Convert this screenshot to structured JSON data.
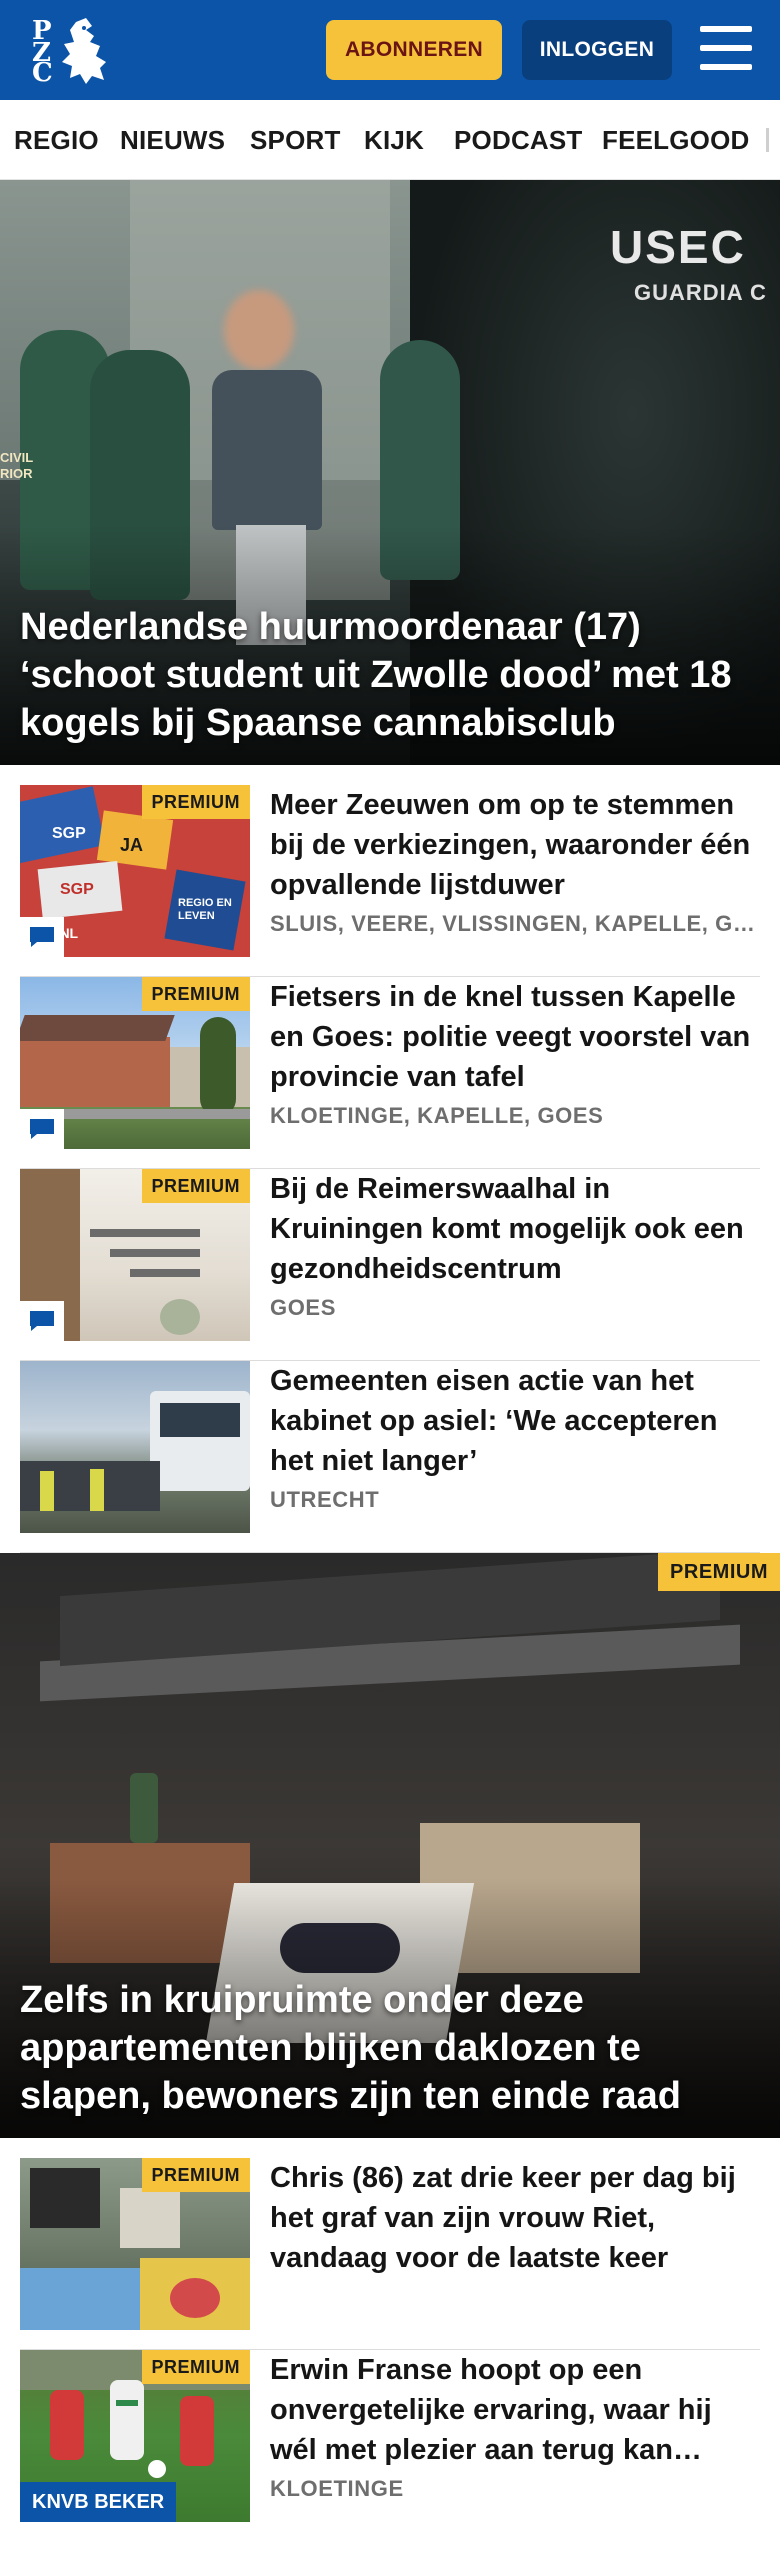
{
  "header": {
    "logo_letters": [
      "P",
      "Z",
      "C"
    ],
    "subscribe_label": "ABONNEREN",
    "login_label": "INLOGGEN",
    "colors": {
      "brand_blue": "#0b54a8",
      "accent_yellow": "#f5c23a"
    }
  },
  "nav": {
    "items": [
      "REGIO",
      "NIEUWS",
      "SPORT",
      "KIJK",
      "PODCAST",
      "FEELGOOD"
    ]
  },
  "hero1": {
    "title": "Nederlandse huurmoordenaar (17) ‘schoot student uit Zwolle dood’ met 18 kogels bij Spaanse cannabisclub",
    "vest_text_1": "USEC",
    "vest_text_2": "GUARDIA C",
    "patch_text": "CIVIL RIOR"
  },
  "articles": [
    {
      "title": "Meer Zeeuwen om op te stemmen bij de verkiezingen, waaronder één opvallende lijstduwer",
      "location": "SLUIS, VEERE, VLISSINGEN, KAPELLE, GOES",
      "premium": "PREMIUM",
      "thumb_texts": [
        "SGP",
        "JA",
        "SGP",
        "BVNL",
        "REGIO EN LEVEN"
      ]
    },
    {
      "title": "Fietsers in de knel tussen Kapelle en Goes: politie veegt voorstel van provincie van tafel",
      "location": "KLOETINGE, KAPELLE, GOES",
      "premium": "PREMIUM"
    },
    {
      "title": "Bij de Reimerswaalhal in Kruiningen komt mogelijk ook een gezondheidscentrum",
      "location": "GOES",
      "premium": "PREMIUM"
    },
    {
      "title": "Gemeenten eisen actie van het kabinet op asiel: ‘We accepteren het niet langer’",
      "location": "UTRECHT"
    }
  ],
  "hero2": {
    "title": "Zelfs in kruipruimte onder deze appartementen blijken daklozen te slapen, bewoners zijn ten einde raad",
    "premium": "PREMIUM"
  },
  "articles2": [
    {
      "title": "Chris (86) zat drie keer per dag bij het graf van zijn vrouw Riet, vandaag voor de laatste keer",
      "premium": "PREMIUM"
    },
    {
      "title": "Erwin Franse hoopt op een onvergetelijke ervaring, waar hij wél met plezier aan terug kan…",
      "location": "KLOETINGE",
      "premium": "PREMIUM",
      "badge": "KNVB BEKER"
    }
  ]
}
